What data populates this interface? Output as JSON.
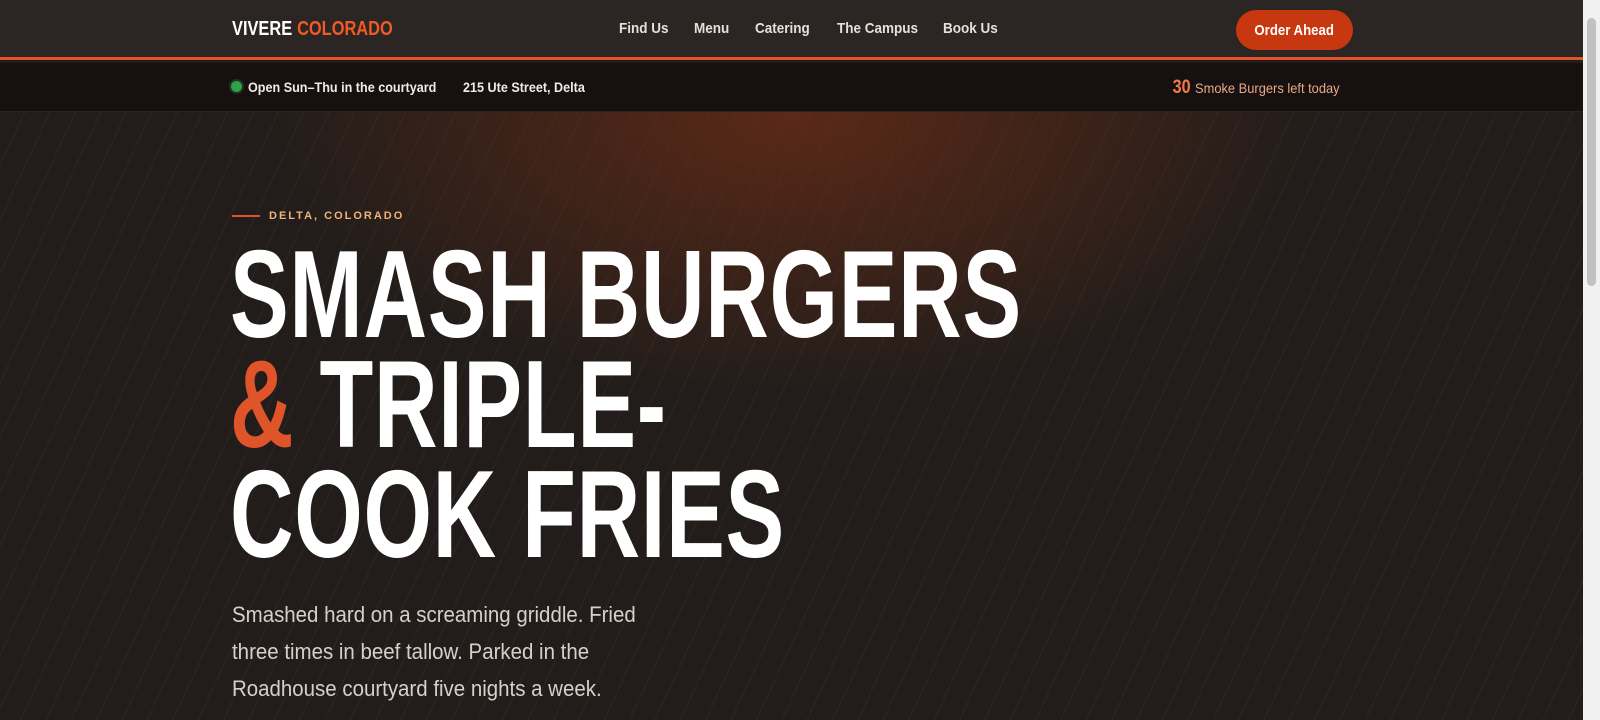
{
  "header": {
    "brand_first": "VIVERE",
    "brand_second": "COLORADO",
    "nav": [
      "Find Us",
      "Menu",
      "Catering",
      "The Campus",
      "Book Us"
    ],
    "cta_label": "Order Ahead"
  },
  "infobar": {
    "status_icon": "status-dot",
    "hours": "Open Sun–Thu in the courtyard",
    "address": "215 Ute Street, Delta",
    "stock_count": "30",
    "stock_label": "Smoke Burgers left today"
  },
  "hero": {
    "eyebrow": "DELTA, COLORADO",
    "headline_line1": "SMASH BURGERS",
    "headline_amp": "&",
    "headline_line2_rest": " TRIPLE-",
    "headline_line3": "COOK FRIES",
    "lede": "Smashed hard on a screaming griddle. Fried three times in beef tallow. Parked in the Roadhouse courtyard five nights a week."
  },
  "colors": {
    "accent": "#e0522a",
    "cta": "#c73710",
    "open_status": "#2fa14a",
    "background": "#221d1a"
  }
}
